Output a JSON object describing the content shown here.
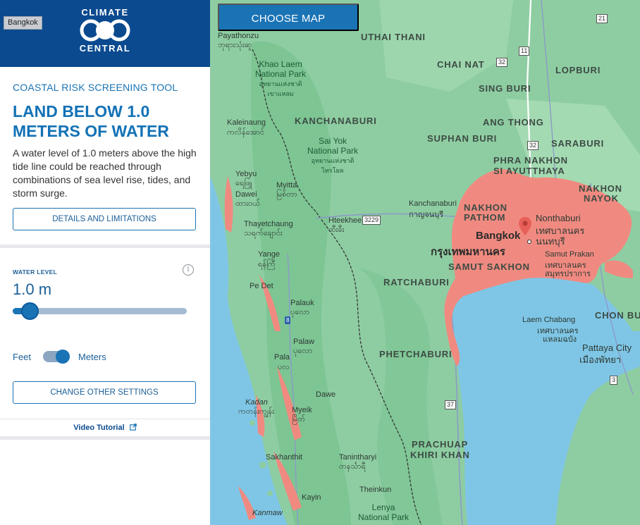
{
  "search": {
    "tag": "Bangkok"
  },
  "brand": {
    "top_word": "CLIMATE",
    "bottom_word": "CENTRAL",
    "color": "#0b4a8f"
  },
  "panel": {
    "tool_label": "COASTAL RISK SCREENING TOOL",
    "headline": "LAND BELOW 1.0 METERS OF WATER",
    "description": "A water level of 1.0 meters above the high tide line could be reached through combinations of sea level rise, tides, and storm surge.",
    "details_button": "DETAILS AND LIMITATIONS",
    "water_level_label": "WATER LEVEL",
    "info_icon": "i",
    "water_level_value": "1.0 m",
    "water_level_fraction": 0.1,
    "unit_feet": "Feet",
    "unit_meters": "Meters",
    "unit_selected": "Meters",
    "settings_button": "CHANGE OTHER SETTINGS",
    "video_link": "Video Tutorial",
    "video_link_icon": "external-link-icon"
  },
  "map": {
    "choose_map_button": "CHOOSE MAP",
    "flood_color": "#f08a80",
    "water_color": "#7fc6e6",
    "land_color": "#8ecda2",
    "marker_icon": "map-pin-icon",
    "provinces": [
      "UTHAI THANI",
      "CHAI NAT",
      "LOPBURI",
      "SING BURI",
      "KANCHANABURI",
      "ANG THONG",
      "SUPHAN BURI",
      "SARABURI",
      "PHRA NAKHON",
      "SI AYUTTHAYA",
      "NAKHON",
      "NAYOK",
      "NAKHON",
      "PATHOM",
      "SAMUT SAKHON",
      "RATCHABURI",
      "PHETCHABURI",
      "PRACHUAP",
      "KHIRI KHAN",
      "CHON BU"
    ],
    "towns": [
      "Payathonzu",
      "ဘုရားသုံးဆူ",
      "Kaleinaung",
      "ကလိန်အောင်",
      "Yebyu",
      "ရေဖြူ",
      "Dawei",
      "ထားဝယ်",
      "Myitta",
      "မြစ်တာ",
      "Thayetchaung",
      "သရက်ချောင်း",
      "Yange",
      "ရန်ကြီ",
      "Pe Det",
      "Hteekhee",
      "ထီးခီး",
      "Palauk",
      "ပုလော",
      "Palaw",
      "ပုလော",
      "Pala",
      "ပလ",
      "Dawe",
      "Kadan",
      "ကတန်းကျွန်း",
      "Myeik",
      "မြိတ်",
      "Sakhanthit",
      "Tanintharyi",
      "တနင်္သာရီ",
      "Theinkun",
      "Kayin",
      "Kanmaw",
      "Kanchanaburi",
      "กาญจนบุรี",
      "Nonthaburi",
      "เทศบาลนคร",
      "นนทบุรี",
      "Samut Prakan",
      "เทศบาลนคร",
      "สมุทรปราการ",
      "Laem Chabang",
      "เทศบาลนคร",
      "แหลมฉบัง",
      "Pattaya City",
      "เมืองพัทยา"
    ],
    "parks": [
      "Khao Laem",
      "National Park",
      "อุทยานแห่งชาติ",
      "เขาแหลม",
      "Sai Yok",
      "National Park",
      "อุทยานแห่งชาติ",
      "ไทรโยค",
      "Lenya",
      "National Park"
    ],
    "city": "Bangkok",
    "city_thai": "กรุงเทพมหานคร",
    "road_shields": [
      "21",
      "11",
      "32",
      "32",
      "3229",
      "8",
      "37",
      "3"
    ]
  }
}
